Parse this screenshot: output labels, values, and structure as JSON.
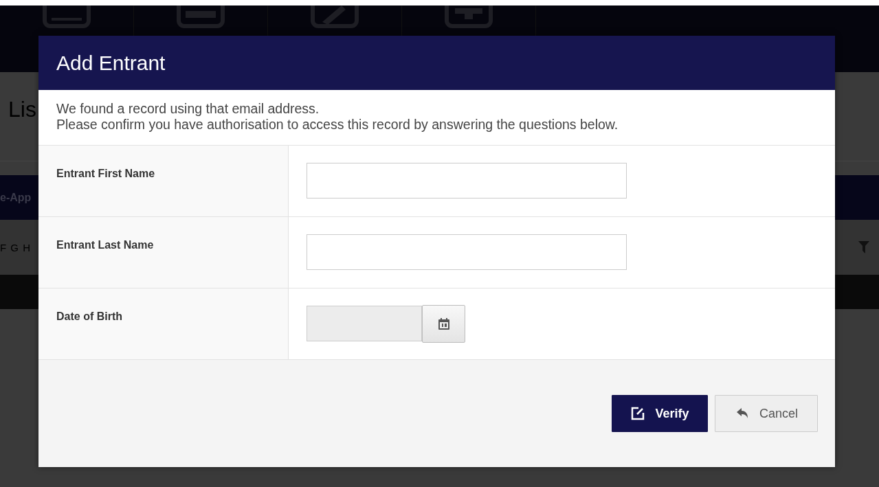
{
  "background": {
    "title": "Lis",
    "tab_bar": "e-App",
    "letters": "F G H"
  },
  "modal": {
    "title": "Add Entrant",
    "message": [
      "We found a record using that email address.",
      "Please confirm you have authorisation to access this record by answering the questions below."
    ],
    "fields": [
      {
        "label": "Entrant First Name",
        "kind": "text"
      },
      {
        "label": "Entrant Last Name",
        "kind": "text"
      },
      {
        "label": "Date of Birth",
        "kind": "date"
      }
    ],
    "buttons": [
      {
        "label": "Verify",
        "kind": "primary"
      },
      {
        "label": "Cancel",
        "kind": "secondary"
      }
    ]
  }
}
